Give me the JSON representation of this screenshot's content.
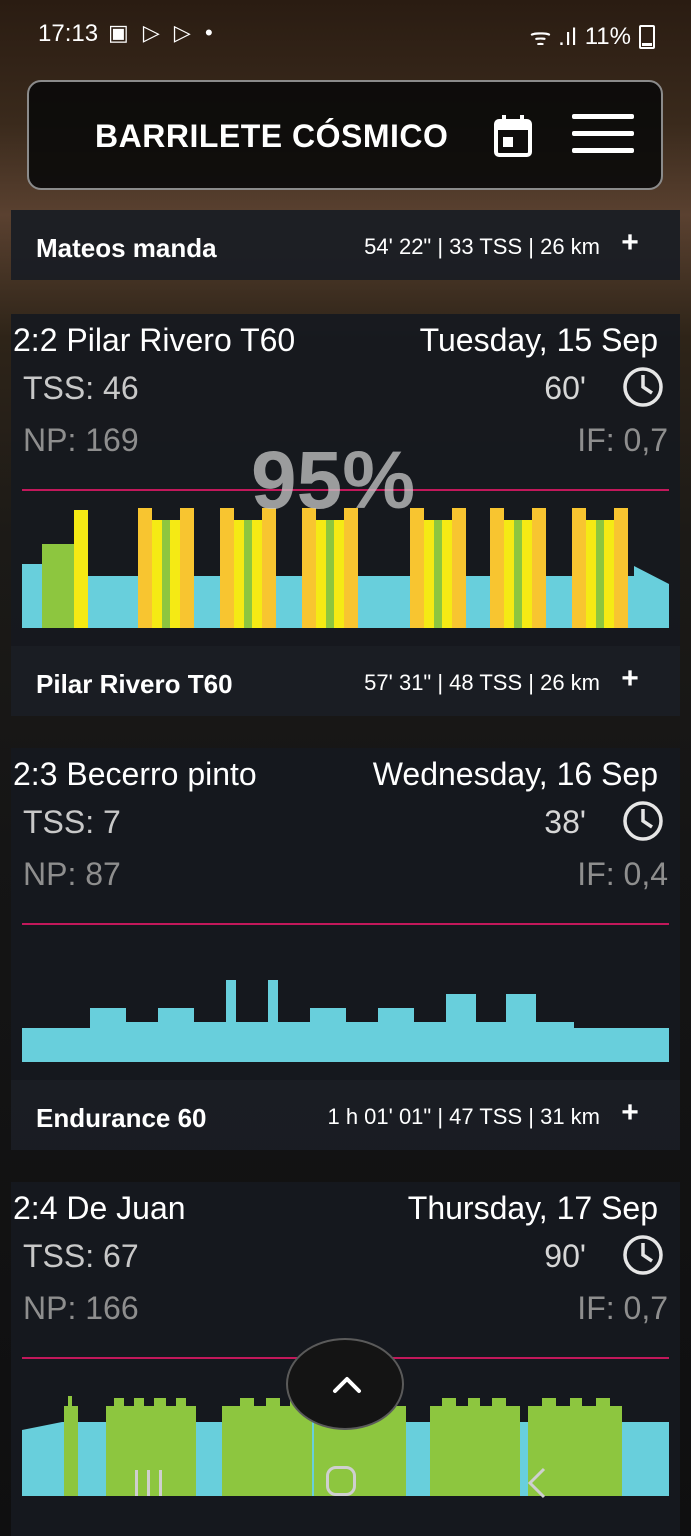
{
  "status": {
    "time": "17:13",
    "left_icons": "▣ ▷ ▷ •",
    "signal": "ᯤ .ıl",
    "battery": "11%"
  },
  "header": {
    "title": "BARRILETE CÓSMICO"
  },
  "summaries": [
    {
      "title": "Mateos manda",
      "stats": "54' 22\" | 33 TSS | 26 km",
      "add": "+"
    },
    {
      "title": "Pilar Rivero T60",
      "stats": "57' 31\" | 48 TSS | 26 km",
      "add": "+"
    },
    {
      "title": "Endurance 60",
      "stats": "1 h 01' 01\" | 47 TSS | 31 km",
      "add": "+"
    }
  ],
  "cards": [
    {
      "title": "2:2 Pilar Rivero T60",
      "date": "Tuesday, 15 Sep",
      "tss": "TSS: 46",
      "np": "NP: 169",
      "duration": "60'",
      "if": "IF: 0,7",
      "percent": "95%"
    },
    {
      "title": "2:3 Becerro pinto",
      "date": "Wednesday, 16 Sep",
      "tss": "TSS: 7",
      "np": "NP: 87",
      "duration": "38'",
      "if": "IF: 0,4"
    },
    {
      "title": "2:4 De Juan",
      "date": "Thursday, 17 Sep",
      "tss": "TSS: 67",
      "np": "NP: 166",
      "duration": "90'",
      "if": "IF: 0,7"
    }
  ],
  "colors": {
    "endurance": "#68cfdc",
    "tempo": "#8dc63f",
    "threshold": "#f5ea14",
    "vo2": "#f8c530",
    "ftp_line": "#c2185b"
  },
  "icons": {
    "calendar": "calendar-icon",
    "menu": "menu-icon",
    "clock": "clock-icon",
    "scroll_up": "chevron-up-icon",
    "nav_recents": "recents-icon",
    "nav_home": "home-icon",
    "nav_back": "back-icon"
  }
}
